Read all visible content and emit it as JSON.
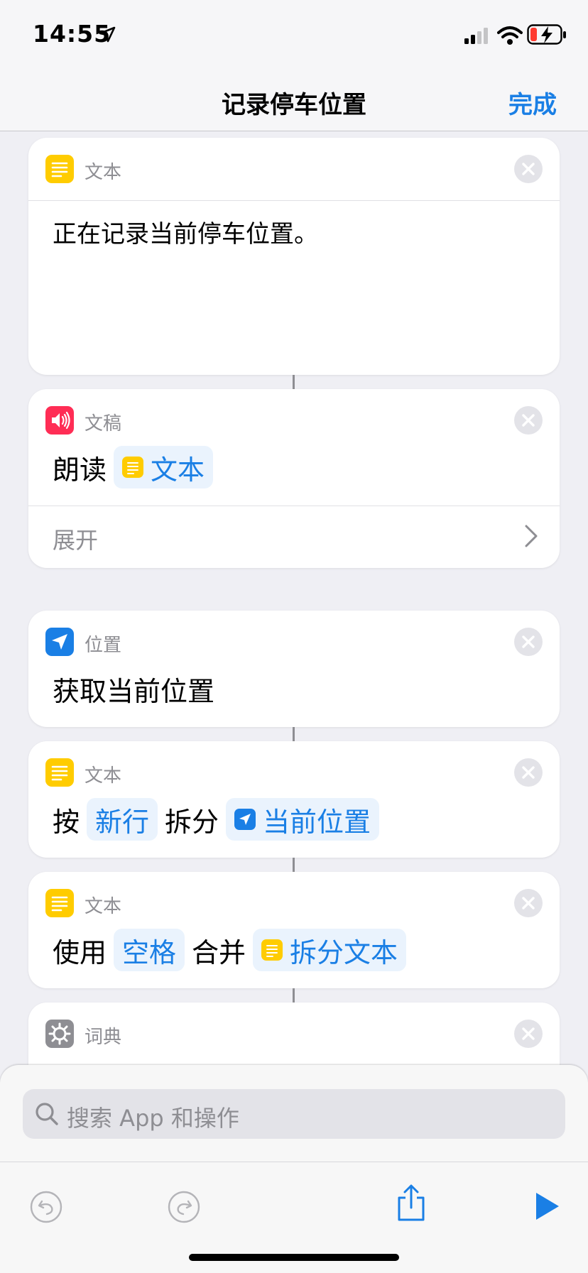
{
  "status_bar": {
    "time": "14:55"
  },
  "nav": {
    "title": "记录停车位置",
    "done_label": "完成"
  },
  "actions": [
    {
      "app": "文本",
      "icon": "text-icon",
      "color": "#FFCC00",
      "body": "正在记录当前停车位置。"
    },
    {
      "app": "文稿",
      "icon": "speaker-icon",
      "color": "#FF2D55",
      "verb": "朗读",
      "token": {
        "icon": "text-icon",
        "label": "文本"
      },
      "expand_label": "展开"
    },
    {
      "app": "位置",
      "icon": "location-arrow-icon",
      "color": "#1A7FE5",
      "title": "获取当前位置"
    },
    {
      "app": "文本",
      "icon": "text-icon",
      "color": "#FFCC00",
      "parts": {
        "w1": "按",
        "t1": "新行",
        "w2": "拆分",
        "t2": "当前位置"
      }
    },
    {
      "app": "文本",
      "icon": "text-icon",
      "color": "#FFCC00",
      "parts": {
        "w1": "使用",
        "t1": "空格",
        "w2": "合并",
        "t2": "拆分文本"
      }
    },
    {
      "app": "词典",
      "icon": "gear-icon",
      "color": "#8E8E93"
    }
  ],
  "search": {
    "placeholder": "搜索 App 和操作"
  },
  "colors": {
    "accent": "#1A7FE5",
    "background": "#EFEFF4",
    "token_bg": "#EAF3FD"
  }
}
